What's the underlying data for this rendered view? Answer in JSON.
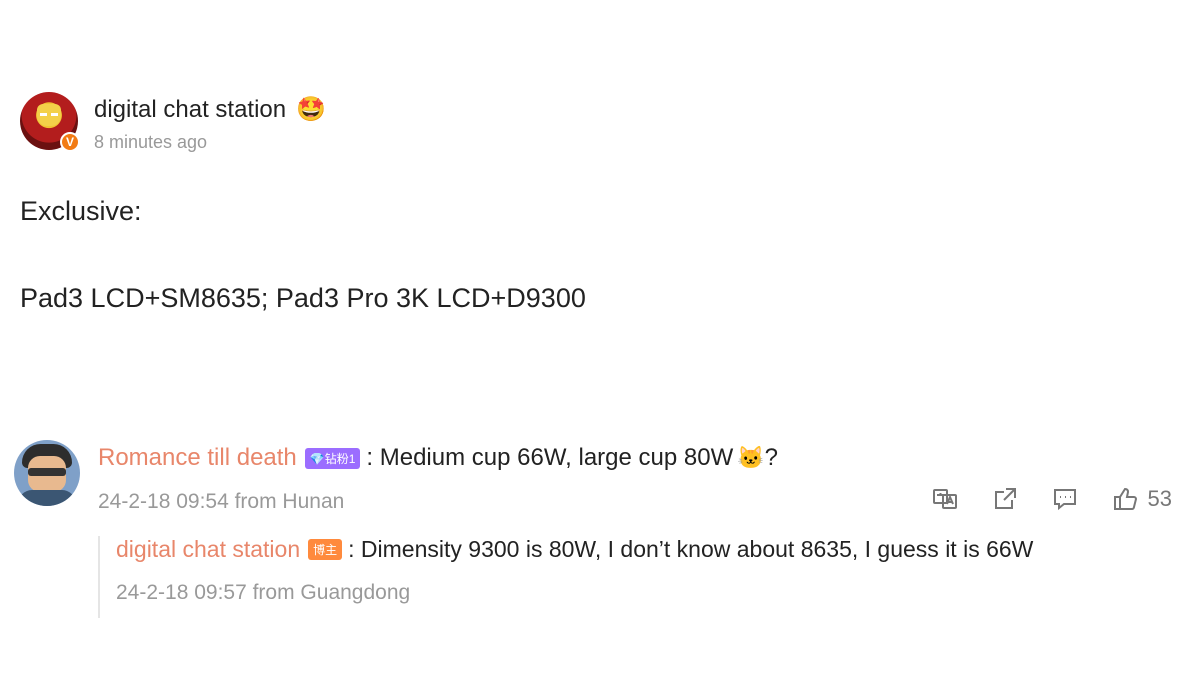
{
  "post": {
    "author": "digital chat station",
    "author_emoji": "🤩",
    "verified_mark": "V",
    "timestamp": "8 minutes ago",
    "body_line1": "Exclusive:",
    "body_line2": "Pad3 LCD+SM8635; Pad3 Pro 3K LCD+D9300"
  },
  "comment": {
    "author": "Romance till death",
    "level_badge": "💎钻粉1",
    "text": ": Medium cup 66W, large cup 80W",
    "emoji": "🐱",
    "suffix": "?",
    "meta": "24-2-18 09:54 from Hunan",
    "like_count": "53",
    "icons": [
      "translate-icon",
      "share-icon",
      "comment-icon",
      "like-icon"
    ]
  },
  "reply": {
    "author": "digital chat station",
    "owner_badge": "博主",
    "text": ": Dimensity 9300 is 80W, I don’t know about 8635, I guess it is 66W",
    "meta": "24-2-18 09:57 from Guangdong"
  },
  "colors": {
    "commenter_name": "#e8866a",
    "meta_gray": "#999999",
    "verified_orange": "#f27b14",
    "level_badge": "#9b6dff",
    "owner_badge": "#ff8a3d"
  }
}
